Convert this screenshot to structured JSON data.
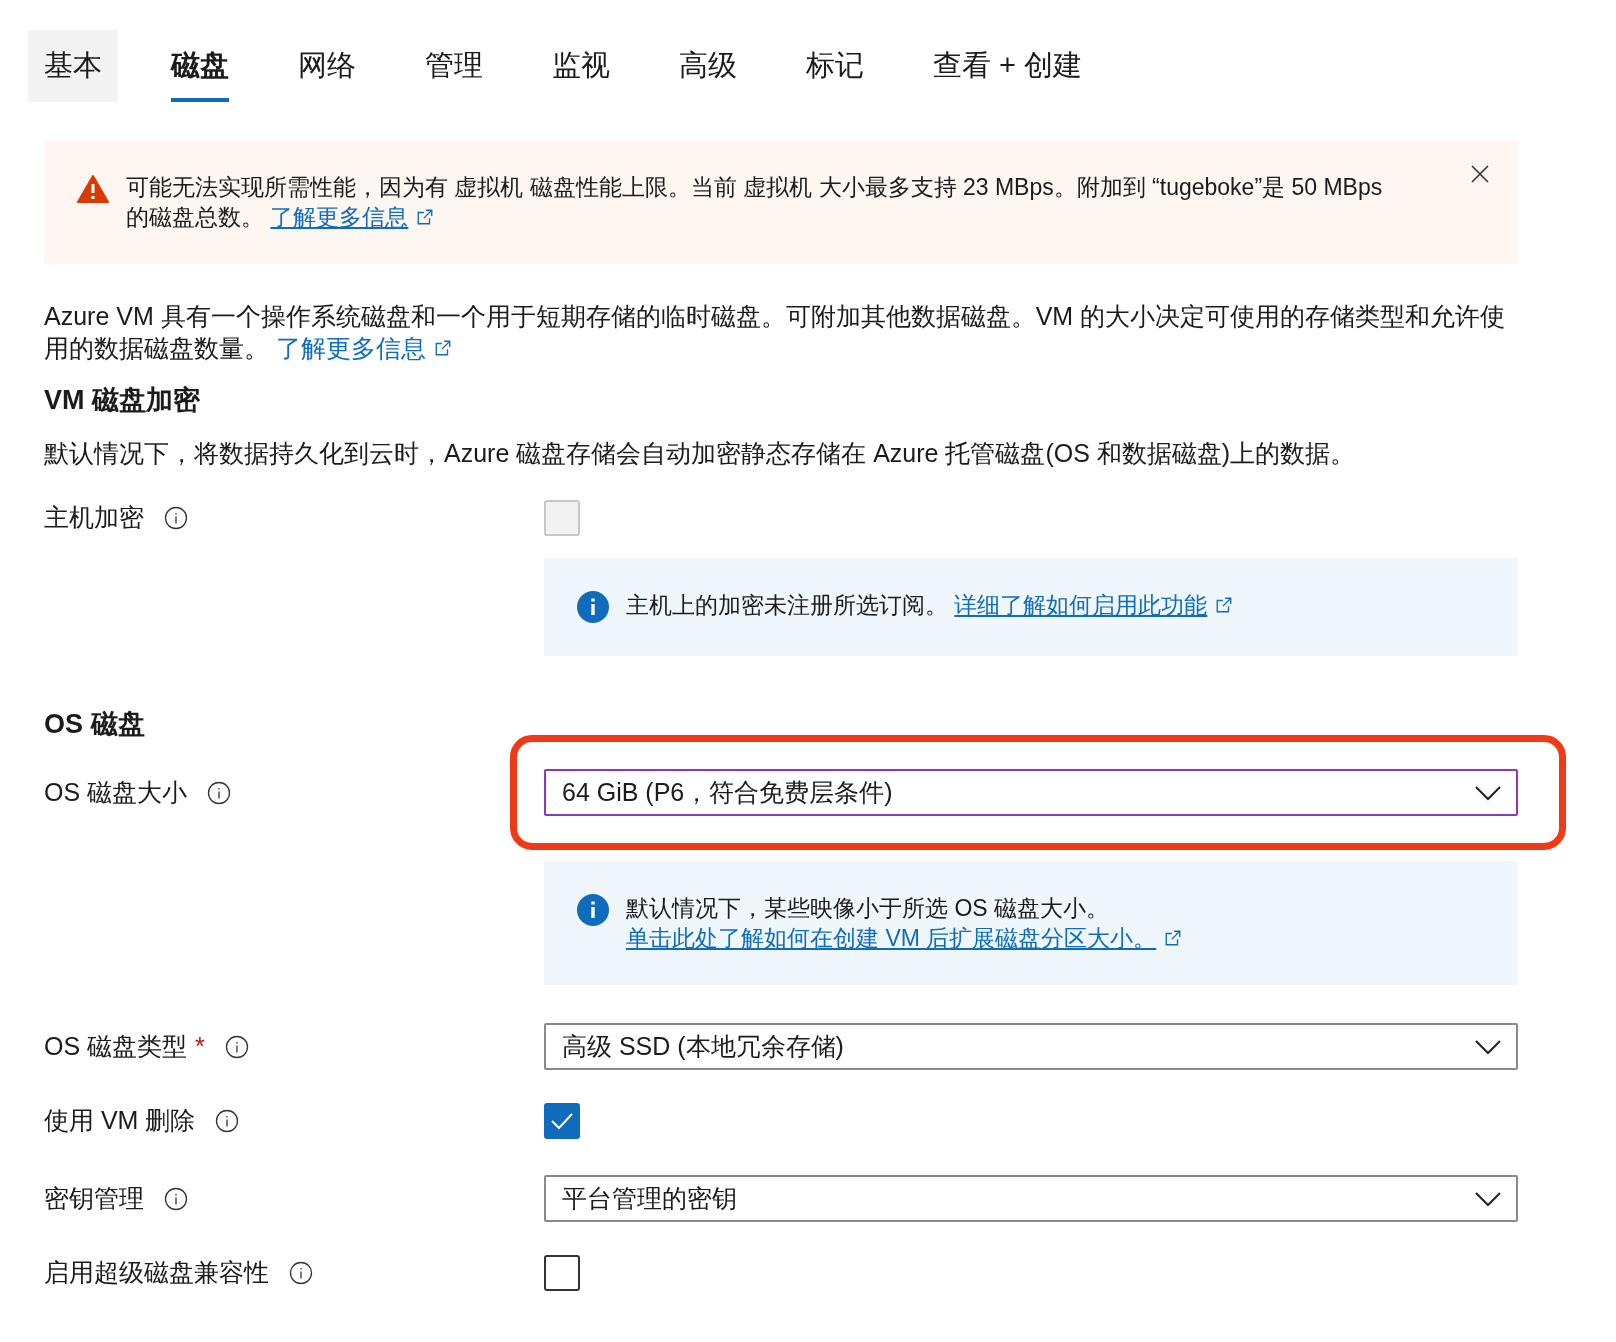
{
  "tabs": [
    {
      "label": "基本",
      "selected": false,
      "hovered": true
    },
    {
      "label": "磁盘",
      "selected": true,
      "hovered": false
    },
    {
      "label": "网络",
      "selected": false,
      "hovered": false
    },
    {
      "label": "管理",
      "selected": false,
      "hovered": false
    },
    {
      "label": "监视",
      "selected": false,
      "hovered": false
    },
    {
      "label": "高级",
      "selected": false,
      "hovered": false
    },
    {
      "label": "标记",
      "selected": false,
      "hovered": false
    },
    {
      "label": "查看 + 创建",
      "selected": false,
      "hovered": false
    }
  ],
  "warning": {
    "text": "可能无法实现所需性能，因为有 虚拟机 磁盘性能上限。当前 虚拟机 大小最多支持 23 MBps。附加到 “tugeboke”是 50 MBps 的磁盘总数。",
    "link": "了解更多信息"
  },
  "intro": {
    "text": "Azure VM 具有一个操作系统磁盘和一个用于短期存储的临时磁盘。可附加其他数据磁盘。VM 的大小决定可使用的存储类型和允许使用的数据磁盘数量。",
    "link": "了解更多信息"
  },
  "sections": [
    {
      "heading": "VM 磁盘加密",
      "description": "默认情况下，将数据持久化到云时，Azure 磁盘存储会自动加密静态存储在 Azure 托管磁盘(OS 和数据磁盘)上的数据。",
      "rows": [
        {
          "kind": "checkbox",
          "label": "主机加密",
          "checked": false,
          "disabled": true,
          "notice": {
            "text": "主机上的加密未注册所选订阅。",
            "link": "详细了解如何启用此功能"
          }
        }
      ]
    },
    {
      "heading": "OS 磁盘",
      "rows": [
        {
          "kind": "select",
          "label": "OS 磁盘大小",
          "value": "64 GiB (P6，符合免费层条件)",
          "focused": true,
          "highlighted": true,
          "notice": {
            "text": "默认情况下，某些映像小于所选 OS 磁盘大小。",
            "link": "单击此处了解如何在创建 VM 后扩展磁盘分区大小。"
          }
        },
        {
          "kind": "select",
          "label": "OS 磁盘类型",
          "required_mark": "*",
          "value": "高级 SSD (本地冗余存储)",
          "focused": false
        },
        {
          "kind": "checkbox",
          "label": "使用 VM 删除",
          "checked": true
        },
        {
          "kind": "select",
          "label": "密钥管理",
          "value": "平台管理的密钥",
          "focused": false
        },
        {
          "kind": "checkbox",
          "label": "启用超级磁盘兼容性",
          "checked": false
        }
      ]
    }
  ]
}
